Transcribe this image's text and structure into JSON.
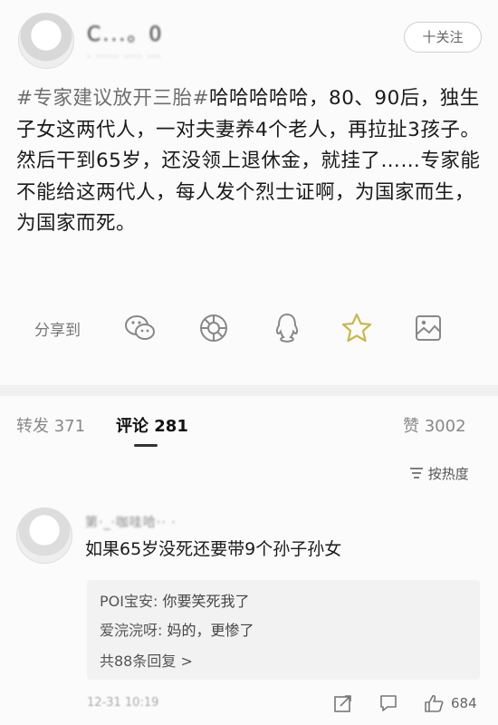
{
  "post": {
    "author_name": "C...。0",
    "author_meta": "·  ·····  ···· ···",
    "follow_label": "十关注",
    "hashtag": "#专家建议放开三胎#",
    "body": "哈哈哈哈哈，80、90后，独生子女这两代人，一对夫妻养4个老人，再拉扯3孩子。然后干到65岁，还没领上退休金，就挂了……专家能不能给这两代人，每人发个烈士证啊，为国家而生，为国家而死。"
  },
  "share": {
    "label": "分享到",
    "icons": [
      "wechat-icon",
      "moments-icon",
      "qq-icon",
      "qzone-icon",
      "save-image-icon"
    ]
  },
  "tabs": {
    "repost": "转发 371",
    "comments": "评论 281",
    "likes": "赞 3002"
  },
  "sort": {
    "label": "按热度",
    "icon": "sort-icon"
  },
  "comment": {
    "author": "第·_·咖哇哈·· ·",
    "text": "如果65岁没死还要带9个孙子孙女",
    "replies": [
      {
        "name": "POI宝安:",
        "text": "你要笑死我了"
      },
      {
        "name": "爱浣浣呀:",
        "text": "妈的，更惨了"
      }
    ],
    "more_replies": "共88条回复 >",
    "time": "12-31 10:19",
    "like_count": "684"
  },
  "colors": {
    "background": "#fbfbfb",
    "reply_bg": "#f2f2f2",
    "share_star": "#c9b84a"
  }
}
